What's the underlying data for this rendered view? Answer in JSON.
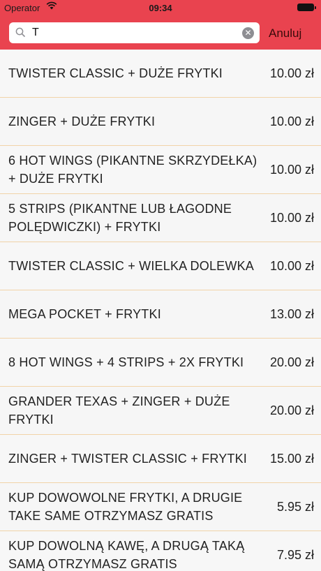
{
  "status_bar": {
    "carrier": "Operator",
    "time": "09:34"
  },
  "search": {
    "query": "T",
    "cancel_label": "Anuluj"
  },
  "colors": {
    "accent": "#e9434f",
    "separator": "#f1d3a8"
  },
  "items": [
    {
      "name": "TWISTER CLASSIC + DUŻE FRYTKI",
      "price": "10.00 zł"
    },
    {
      "name": "ZINGER + DUŻE FRYTKI",
      "price": "10.00 zł"
    },
    {
      "name": "6 HOT WINGS (PIKANTNE SKRZYDEŁKA) + DUŻE FRYTKI",
      "price": "10.00 zł"
    },
    {
      "name": "5 STRIPS (PIKANTNE LUB ŁAGODNE POLĘDWICZKI) + FRYTKI",
      "price": "10.00 zł"
    },
    {
      "name": "TWISTER CLASSIC + WIELKA DOLEWKA",
      "price": "10.00 zł"
    },
    {
      "name": "MEGA POCKET + FRYTKI",
      "price": "13.00 zł"
    },
    {
      "name": "8 HOT WINGS + 4 STRIPS + 2X FRYTKI",
      "price": "20.00 zł"
    },
    {
      "name": "GRANDER TEXAS + ZINGER + DUŻE FRYTKI",
      "price": "20.00 zł"
    },
    {
      "name": "ZINGER + TWISTER CLASSIC + FRYTKI",
      "price": "15.00 zł"
    },
    {
      "name": "KUP DOWOWOLNE FRYTKI, A DRUGIE TAKE SAME OTRZYMASZ GRATIS",
      "price": "5.95 zł"
    },
    {
      "name": "KUP DOWOLNĄ KAWĘ, A DRUGĄ TAKĄ SAMĄ OTRZYMASZ GRATIS",
      "price": "7.95 zł"
    }
  ]
}
